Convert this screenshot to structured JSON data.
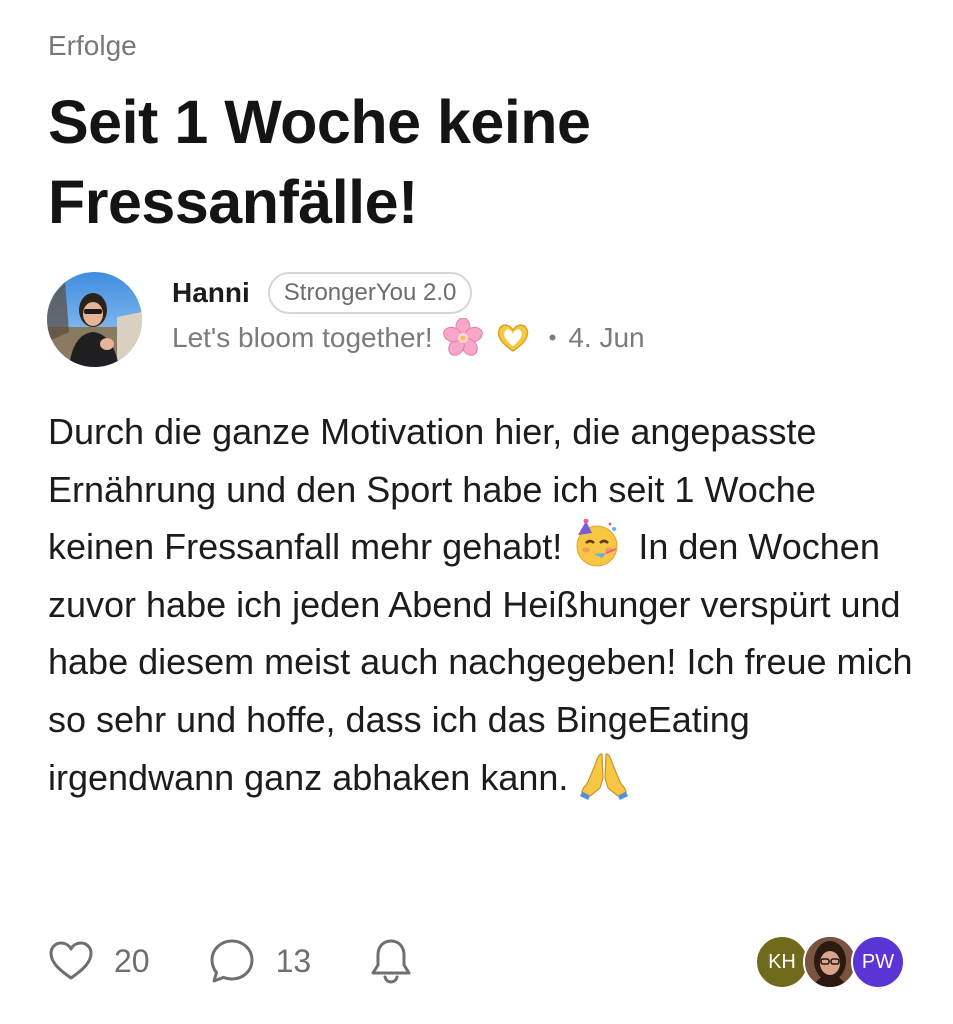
{
  "post": {
    "category": "Erfolge",
    "title": "Seit 1 Woche keine Fressanfälle!",
    "author": {
      "name": "Hanni",
      "badge": "StrongerYou 2.0",
      "tagline": "Let's bloom together!",
      "tagline_emojis": [
        "cherry-blossom-icon",
        "heart-hands-icon"
      ],
      "date": "4. Jun",
      "avatar": "user-photo-avatar"
    },
    "body": {
      "part1": "Durch die ganze Motivation hier, die angepasste Ernährung und den Sport habe ich seit 1 Woche keinen Fressanfall mehr gehabt!",
      "emoji1": "partying-face-icon",
      "part2": "In den Wochen zuvor habe ich jeden Abend Heißhunger verspürt und habe diesem meist auch nachgegeben! Ich freue mich so sehr und hoffe, dass ich das BingeEating irgendwann ganz abhaken kann.",
      "emoji2": "folded-hands-icon"
    }
  },
  "actions": {
    "likes_icon": "heart-icon",
    "likes_count": "20",
    "comments_icon": "comment-bubble-icon",
    "comments_count": "13",
    "notify_icon": "bell-icon"
  },
  "participants": [
    {
      "initials": "KH",
      "color": "#6f6a1c"
    },
    {
      "initials": "",
      "type": "photo"
    },
    {
      "initials": "PW",
      "color": "#5b34d6"
    }
  ]
}
